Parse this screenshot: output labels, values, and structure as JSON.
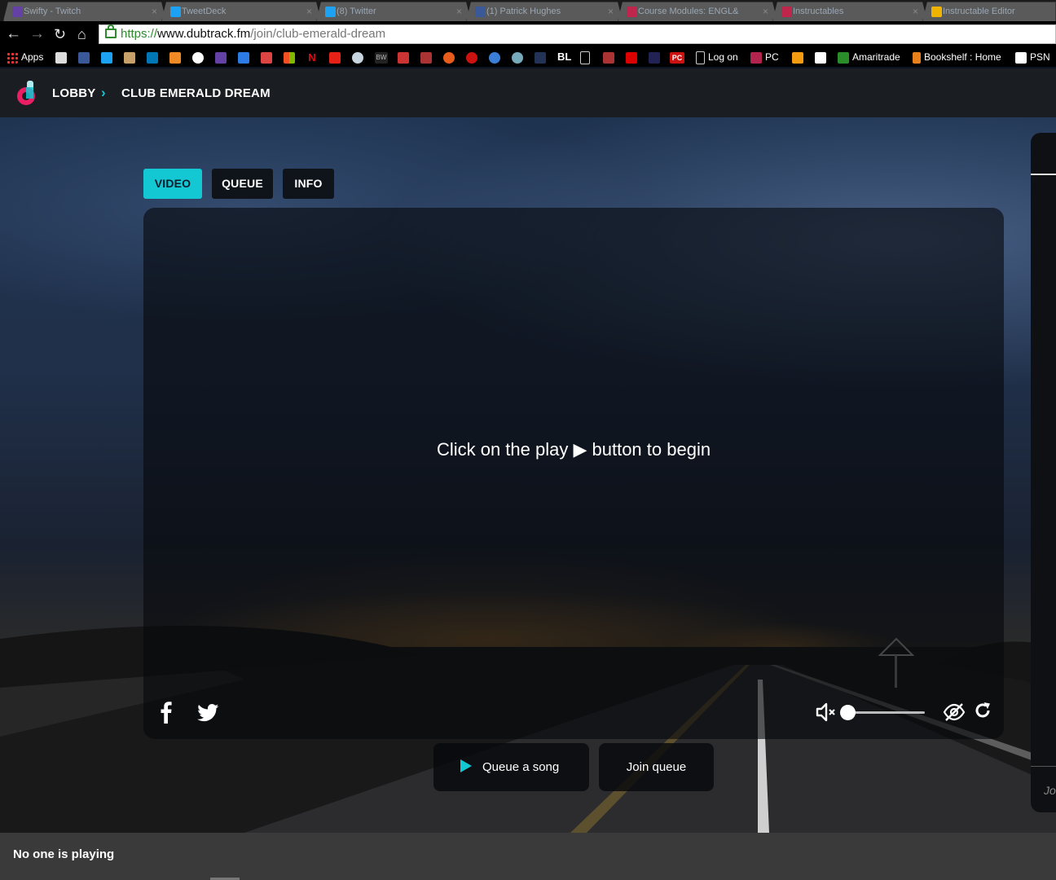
{
  "browser": {
    "tabs": [
      {
        "title": "Swifty - Twitch",
        "color": "#6441a5"
      },
      {
        "title": "TweetDeck",
        "color": "#1da1f2"
      },
      {
        "title": "(8) Twitter",
        "color": "#1da1f2"
      },
      {
        "title": "(1) Patrick Hughes",
        "color": "#3b5998"
      },
      {
        "title": "Course Modules: ENGL&",
        "color": "#c0254b"
      },
      {
        "title": "Instructables",
        "color": "#c0254b"
      },
      {
        "title": "Instructable Editor",
        "color": "#f0b400"
      }
    ],
    "url": {
      "scheme": "https://",
      "host": "www.dubtrack.fm",
      "path": "/join/club-emerald-dream"
    },
    "bookmarks": {
      "apps": "Apps",
      "logon": "Log on",
      "pc": "PC",
      "amaritrade": "Amaritrade",
      "bookshelf": "Bookshelf : Home",
      "psn": "PSN",
      "bl": "BL",
      "pc_box": "PC",
      "bw": "BW"
    }
  },
  "header": {
    "lobby": "LOBBY",
    "room": "CLUB EMERALD DREAM"
  },
  "player": {
    "tabs": [
      "VIDEO",
      "QUEUE",
      "INFO"
    ],
    "active_tab": "VIDEO",
    "message": "Click on the play ▶ button to begin",
    "volume": 0.0
  },
  "actions": {
    "queue_song": "Queue a song",
    "join_queue": "Join queue"
  },
  "sidebar": {
    "partial_text": "Jo"
  },
  "footer": {
    "status": "No one is playing"
  },
  "colors": {
    "accent": "#14c8d3",
    "header_bg": "#1a1d22",
    "footer_bg": "#3a3a3a"
  }
}
